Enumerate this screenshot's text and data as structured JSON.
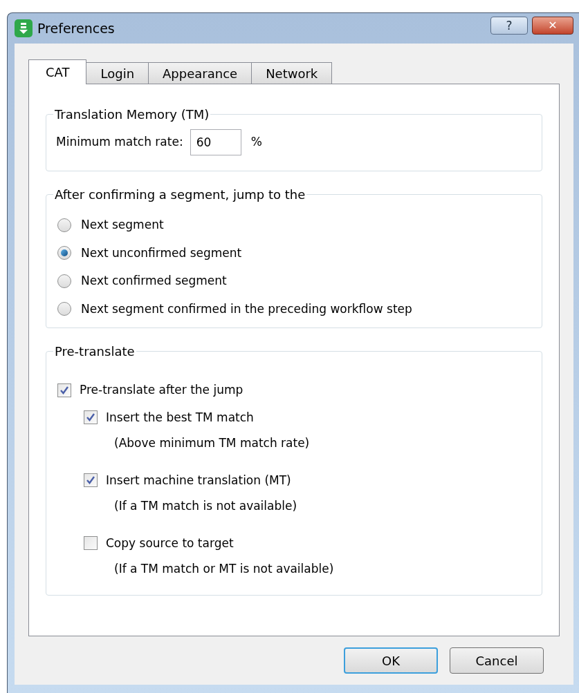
{
  "window": {
    "title": "Preferences"
  },
  "title_buttons": [
    {
      "kind": "help",
      "label": "?"
    },
    {
      "kind": "close",
      "label": "✕"
    }
  ],
  "tabs": [
    {
      "label": "CAT",
      "selected": true
    },
    {
      "label": "Login",
      "selected": false
    },
    {
      "label": "Appearance",
      "selected": false
    },
    {
      "label": "Network",
      "selected": false
    }
  ],
  "translation_memory": {
    "title": "Translation Memory (TM)",
    "label": "Minimum match rate:",
    "value": "60",
    "unit": "%"
  },
  "jump": {
    "title": "After confirming a segment, jump to the",
    "options": [
      {
        "label": "Next segment",
        "selected": false
      },
      {
        "label": "Next unconfirmed segment",
        "selected": true
      },
      {
        "label": "Next confirmed segment",
        "selected": false
      },
      {
        "label": "Next segment confirmed in the preceding workflow step",
        "selected": false
      }
    ]
  },
  "pretranslate": {
    "title": "Pre-translate",
    "options": [
      {
        "label": "Pre-translate after the jump",
        "checked": true,
        "children": [
          {
            "label": "Insert the best TM match",
            "checked": true,
            "note": "(Above minimum TM match rate)"
          },
          {
            "label": "Insert machine translation (MT)",
            "checked": true,
            "note": "(If a TM match is not available)"
          },
          {
            "label": "Copy source to target",
            "checked": false,
            "note": "(If a TM match or MT is not available)"
          }
        ]
      }
    ]
  },
  "buttons": [
    {
      "label": "OK",
      "default": true
    },
    {
      "label": "Cancel",
      "default": false
    }
  ]
}
